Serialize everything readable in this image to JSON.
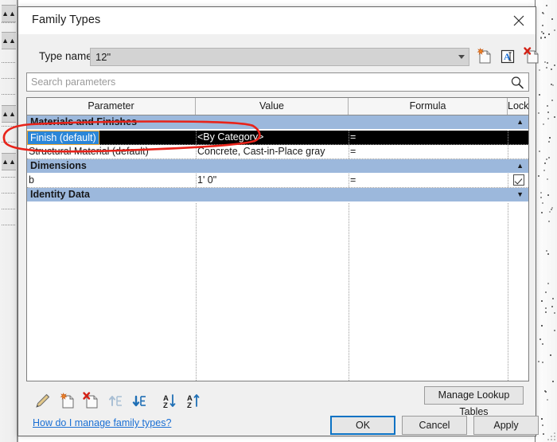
{
  "dialog": {
    "title": "Family Types",
    "close_icon": "close-icon"
  },
  "type_name": {
    "label": "Type name:",
    "value": "12\"",
    "dropdown_icon": "chevron-down-icon",
    "actions": [
      {
        "name": "new-type-icon",
        "tooltip": "New Type"
      },
      {
        "name": "rename-type-icon",
        "tooltip": "Rename"
      },
      {
        "name": "delete-type-icon",
        "tooltip": "Delete"
      }
    ]
  },
  "search": {
    "placeholder": "Search parameters",
    "icon": "search-icon"
  },
  "table": {
    "columns": [
      "Parameter",
      "Value",
      "Formula",
      "Lock"
    ],
    "groups": [
      {
        "name": "Materials and Finishes",
        "chevron": "collapse-up",
        "rows": [
          {
            "parameter": "Finish (default)",
            "value": "<By Category>",
            "formula": "=",
            "lock": "",
            "selected": true,
            "editing": true
          },
          {
            "parameter": "Structural Material (default)",
            "value": "Concrete, Cast-in-Place gray",
            "formula": "=",
            "lock": "",
            "selected": false,
            "editing": false
          }
        ]
      },
      {
        "name": "Dimensions",
        "chevron": "collapse-up",
        "rows": [
          {
            "parameter": "b",
            "value": "1'  0\"",
            "formula": "=",
            "lock": "checked",
            "selected": false,
            "editing": false
          }
        ]
      },
      {
        "name": "Identity Data",
        "chevron": "expand-down",
        "rows": []
      }
    ]
  },
  "toolbar": [
    {
      "name": "edit-parameter-icon",
      "label": "Edit Parameter"
    },
    {
      "name": "new-parameter-icon",
      "label": "New Parameter"
    },
    {
      "name": "delete-parameter-icon",
      "label": "Remove Parameter"
    },
    {
      "name": "move-up-icon",
      "label": "Move Up",
      "disabled": true
    },
    {
      "name": "move-down-icon",
      "label": "Move Down",
      "disabled": false
    },
    {
      "name": "sort-descending-icon",
      "label": "Sort Descending"
    },
    {
      "name": "sort-ascending-icon",
      "label": "Sort Ascending"
    }
  ],
  "help_link": "How do I manage family types?",
  "buttons": {
    "lookup_tables": "Manage Lookup Tables",
    "ok": "OK",
    "cancel": "Cancel",
    "apply": "Apply"
  },
  "annotation": {
    "color": "#e8231a",
    "shape": "ellipse-highlight"
  },
  "colors": {
    "group_header": "#9cb8dc",
    "selection": "#2a86d8",
    "selected_row": "#000000",
    "link": "#1a6fd4",
    "default_button_border": "#0a72c4",
    "annotation_red": "#e8231a"
  }
}
